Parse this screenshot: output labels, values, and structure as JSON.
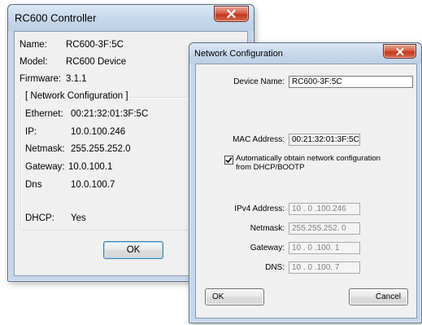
{
  "controller_window": {
    "title": "RC600 Controller",
    "name_label": "Name:",
    "name_value": "RC600-3F:5C",
    "model_label": "Model:",
    "model_value": "RC600 Device",
    "firmware_label": "Firmware:",
    "firmware_value": "3.1.1",
    "group_legend": "[ Network Configuration ]",
    "ethernet_label": "Ethernet:",
    "ethernet_value": "00:21:32:01:3F:5C",
    "ip_label": "IP:",
    "ip_value": "10.0.100.246",
    "netmask_label": "Netmask:",
    "netmask_value": "255.255.252.0",
    "gateway_label": "Gateway:",
    "gateway_value": "10.0.100.1",
    "dns_label": "Dns",
    "dns_value": "10.0.100.7",
    "dhcp_label": "DHCP:",
    "dhcp_value": "Yes",
    "ok_label": "OK"
  },
  "network_window": {
    "title": "Network Configuration",
    "device_name_label": "Device Name:",
    "device_name_value": "RC600-3F:5C",
    "mac_label": "MAC Address:",
    "mac_value": "00:21:32:01:3F:5C",
    "dhcp_checkbox_checked": true,
    "dhcp_checkbox_line1": "Automatically obtain network configuration",
    "dhcp_checkbox_line2": "from DHCP/BOOTP",
    "ipv4_label": "IPv4 Address:",
    "ipv4_value": "10 . 0 .100.246",
    "netmask_label": "Netmask:",
    "netmask_value": "255.255.252. 0",
    "gateway_label": "Gateway:",
    "gateway_value": "10 . 0 .100. 1",
    "dns_label": "DNS:",
    "dns_value": "10 . 0 .100. 7",
    "ok_label": "OK",
    "cancel_label": "Cancel"
  },
  "colors": {
    "title_bar": "#c4d6ea",
    "close_button": "#c4371f",
    "dialog_face": "#f0f0f0"
  },
  "icons": {
    "close": "close-icon",
    "checkbox": "checkmark-icon"
  }
}
